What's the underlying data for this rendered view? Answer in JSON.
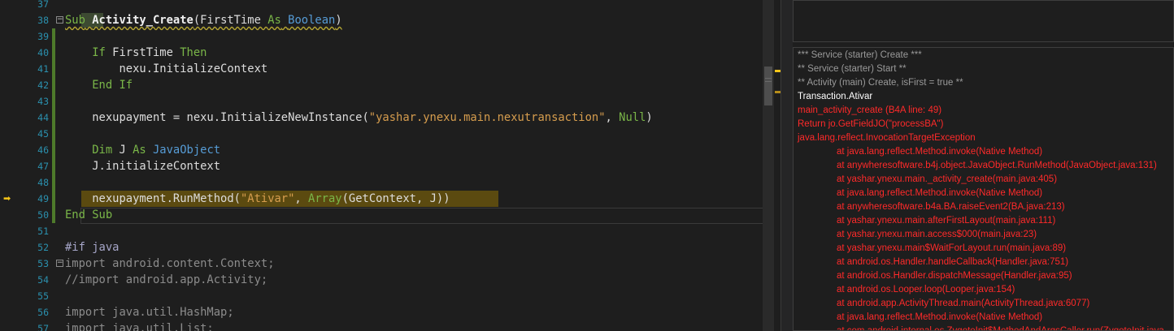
{
  "editor": {
    "lines": [
      {
        "num": "37",
        "tokens": []
      },
      {
        "num": "38",
        "tokens": [
          [
            "Sub",
            "kw sq"
          ],
          [
            " ",
            "pl sq"
          ],
          [
            "Activity_Create",
            "bold sq"
          ],
          [
            "(FirstTime ",
            "pl sq"
          ],
          [
            "As",
            "kw sq"
          ],
          [
            " ",
            "pl sq"
          ],
          [
            "Boolean",
            "ty sq"
          ],
          [
            ")",
            "pl sq"
          ]
        ]
      },
      {
        "num": "39",
        "tokens": []
      },
      {
        "num": "40",
        "tokens": [
          [
            "    If ",
            "kw"
          ],
          [
            "FirstTime ",
            "pl"
          ],
          [
            "Then",
            "kw"
          ]
        ]
      },
      {
        "num": "41",
        "tokens": [
          [
            "        nexu.InitializeContext",
            "pl"
          ]
        ]
      },
      {
        "num": "42",
        "tokens": [
          [
            "    End If",
            "kw"
          ]
        ]
      },
      {
        "num": "43",
        "tokens": []
      },
      {
        "num": "44",
        "tokens": [
          [
            "    nexupayment = nexu.InitializeNewInstance(",
            "pl"
          ],
          [
            "\"yashar.ynexu.main.nexutransaction\"",
            "st"
          ],
          [
            ", ",
            "pl"
          ],
          [
            "Null",
            "kw"
          ],
          [
            ")",
            "pl"
          ]
        ]
      },
      {
        "num": "45",
        "tokens": []
      },
      {
        "num": "46",
        "tokens": [
          [
            "    Dim ",
            "kw"
          ],
          [
            "J ",
            "pl"
          ],
          [
            "As ",
            "kw"
          ],
          [
            "JavaObject",
            "ty"
          ]
        ]
      },
      {
        "num": "47",
        "tokens": [
          [
            "    J.initializeContext",
            "pl"
          ]
        ]
      },
      {
        "num": "48",
        "tokens": []
      },
      {
        "num": "49",
        "tokens": [
          [
            "    nexupayment.RunMethod(",
            "pl"
          ],
          [
            "\"Ativar\"",
            "st"
          ],
          [
            ", ",
            "pl"
          ],
          [
            "Array",
            "kw"
          ],
          [
            "(GetContext, J))",
            "pl"
          ]
        ]
      },
      {
        "num": "50",
        "tokens": [
          [
            "End Sub",
            "kw"
          ]
        ]
      },
      {
        "num": "51",
        "tokens": []
      },
      {
        "num": "52",
        "tokens": [
          [
            "#if java",
            "pp"
          ]
        ]
      },
      {
        "num": "53",
        "tokens": [
          [
            "import android.content.Context;",
            "gr"
          ]
        ]
      },
      {
        "num": "54",
        "tokens": [
          [
            "//import android.app.Activity;",
            "gr"
          ]
        ]
      },
      {
        "num": "55",
        "tokens": []
      },
      {
        "num": "56",
        "tokens": [
          [
            "import java.util.HashMap;",
            "gr"
          ]
        ]
      },
      {
        "num": "57",
        "tokens": [
          [
            "import java.util.List;",
            "gr"
          ]
        ]
      }
    ]
  },
  "log": {
    "lines": [
      {
        "text": "*** Service (starter) Create ***",
        "style": "gray",
        "indent": false
      },
      {
        "text": "** Service (starter) Start **",
        "style": "gray",
        "indent": false
      },
      {
        "text": "** Activity (main) Create, isFirst = true **",
        "style": "gray",
        "indent": false
      },
      {
        "text": "Transaction.Ativar",
        "style": "white",
        "indent": false
      },
      {
        "text": "main_activity_create (B4A line: 49)",
        "style": "red",
        "indent": false
      },
      {
        "text": "Return jo.GetFieldJO(\"processBA\")",
        "style": "red",
        "indent": false
      },
      {
        "text": "java.lang.reflect.InvocationTargetException",
        "style": "red",
        "indent": false
      },
      {
        "text": "at java.lang.reflect.Method.invoke(Native Method)",
        "style": "red",
        "indent": true
      },
      {
        "text": "at anywheresoftware.b4j.object.JavaObject.RunMethod(JavaObject.java:131)",
        "style": "red",
        "indent": true
      },
      {
        "text": "at yashar.ynexu.main._activity_create(main.java:405)",
        "style": "red",
        "indent": true
      },
      {
        "text": "at java.lang.reflect.Method.invoke(Native Method)",
        "style": "red",
        "indent": true
      },
      {
        "text": "at anywheresoftware.b4a.BA.raiseEvent2(BA.java:213)",
        "style": "red",
        "indent": true
      },
      {
        "text": "at yashar.ynexu.main.afterFirstLayout(main.java:111)",
        "style": "red",
        "indent": true
      },
      {
        "text": "at yashar.ynexu.main.access$000(main.java:23)",
        "style": "red",
        "indent": true
      },
      {
        "text": "at yashar.ynexu.main$WaitForLayout.run(main.java:89)",
        "style": "red",
        "indent": true
      },
      {
        "text": "at android.os.Handler.handleCallback(Handler.java:751)",
        "style": "red",
        "indent": true
      },
      {
        "text": "at android.os.Handler.dispatchMessage(Handler.java:95)",
        "style": "red",
        "indent": true
      },
      {
        "text": "at android.os.Looper.loop(Looper.java:154)",
        "style": "red",
        "indent": true
      },
      {
        "text": "at android.app.ActivityThread.main(ActivityThread.java:6077)",
        "style": "red",
        "indent": true
      },
      {
        "text": "at java.lang.reflect.Method.invoke(Native Method)",
        "style": "red",
        "indent": true
      },
      {
        "text": "at com.android.internal.os.ZygoteInit$MethodAndArgsCaller.run(ZygoteInit.java",
        "style": "red",
        "indent": true
      }
    ]
  },
  "icons": {
    "breakpoint": "current-line-arrow-icon",
    "fold": "fold-minus-icon"
  },
  "colors": {
    "keyword": "#7ab648",
    "type": "#569cd6",
    "string": "#d69d4e",
    "error": "#ff2a2a",
    "highlight": "#5b4a10"
  }
}
